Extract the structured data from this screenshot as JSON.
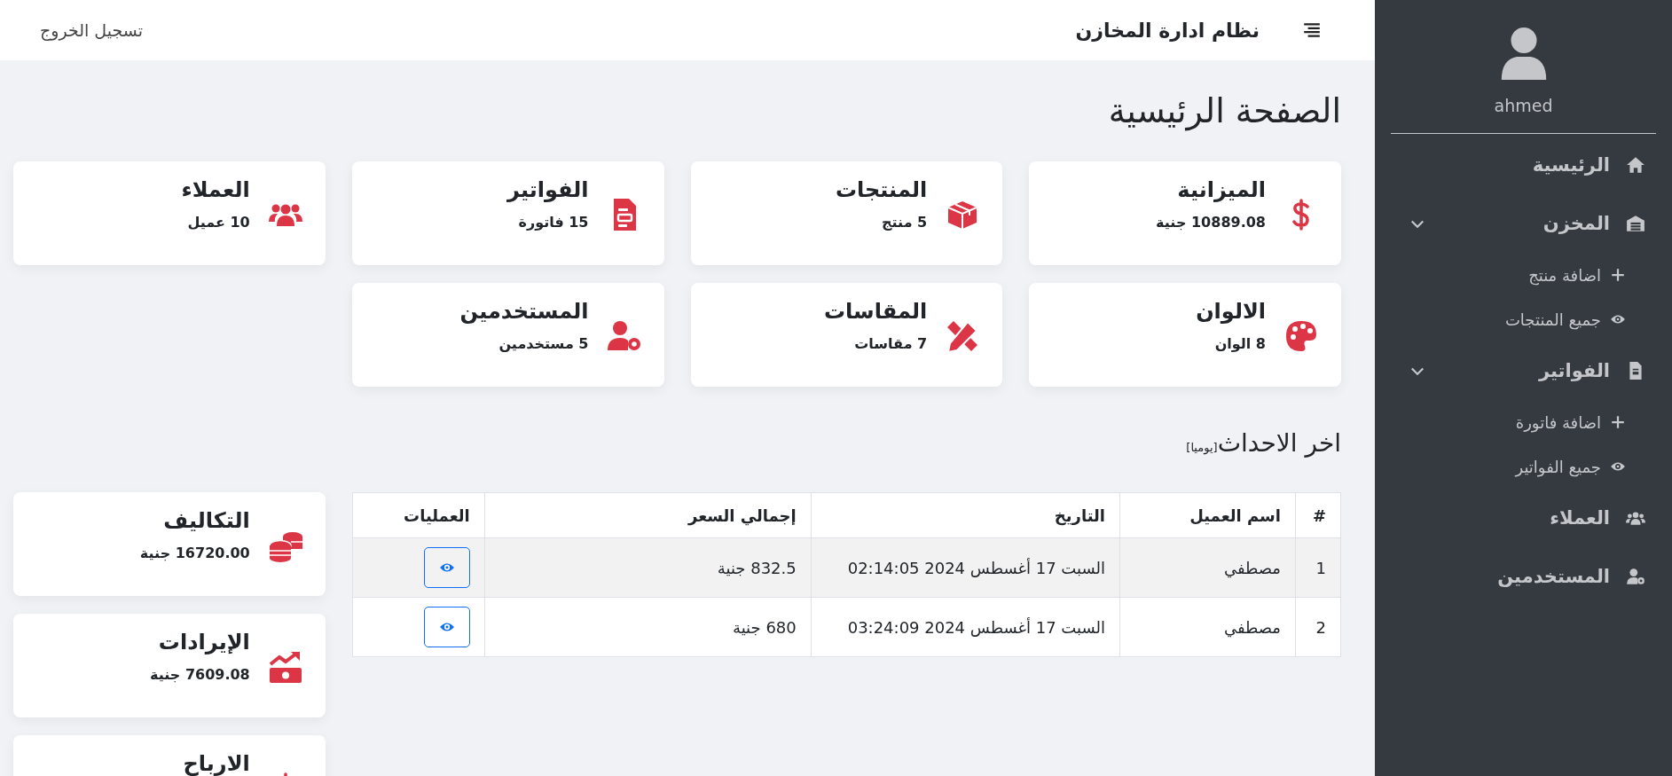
{
  "header": {
    "title": "نظام ادارة المخازن",
    "logout": "تسجيل الخروج"
  },
  "sidebar": {
    "user": "ahmed",
    "items": [
      {
        "label": "الرئيسية"
      },
      {
        "label": "المخزن",
        "expanded": true,
        "children": [
          {
            "label": "اضافة منتج"
          },
          {
            "label": "جميع المنتجات"
          }
        ]
      },
      {
        "label": "الفواتير",
        "expanded": true,
        "children": [
          {
            "label": "اضافة فاتورة"
          },
          {
            "label": "جميع الفواتير"
          }
        ]
      },
      {
        "label": "العملاء"
      },
      {
        "label": "المستخدمين"
      }
    ]
  },
  "page_title": "الصفحة الرئيسية",
  "stats": [
    {
      "title": "الميزانية",
      "value": "10889.08 جنية"
    },
    {
      "title": "المنتجات",
      "value": "5 منتج"
    },
    {
      "title": "الفواتير",
      "value": "15 فاتورة"
    },
    {
      "title": "العملاء",
      "value": "10 عميل"
    },
    {
      "title": "الالوان",
      "value": "8 الوان"
    },
    {
      "title": "المقاسات",
      "value": "7 مقاسات"
    },
    {
      "title": "المستخدمين",
      "value": "5 مستخدمين"
    }
  ],
  "recent": {
    "title": "اخر الاحداث",
    "period": "[يوميا]",
    "columns": [
      "#",
      "اسم العميل",
      "التاريخ",
      "إجمالي السعر",
      "العمليات"
    ],
    "rows": [
      {
        "cells": [
          "1",
          "مصطفي",
          "السبت 17 أغسطس 2024 02:14:05",
          "832.5 جنية"
        ]
      },
      {
        "cells": [
          "2",
          "مصطفي",
          "السبت 17 أغسطس 2024 03:24:09",
          "680 جنية"
        ]
      }
    ]
  },
  "finance": [
    {
      "title": "التكاليف",
      "value": "16720.00 جنية"
    },
    {
      "title": "الإيرادات",
      "value": "7609.08 جنية"
    },
    {
      "title": "الارباح"
    }
  ]
}
